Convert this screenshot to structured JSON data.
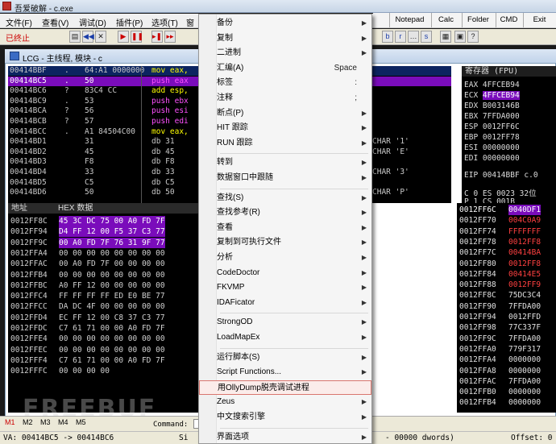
{
  "window": {
    "title": "吾爱破解 - c.exe"
  },
  "menu": [
    "文件(F)",
    "查看(V)",
    "调试(D)",
    "插件(P)",
    "选项(T)",
    "窗"
  ],
  "top_tabs": [
    "Notepad",
    "Calc",
    "Folder",
    "CMD",
    "Exit"
  ],
  "status": {
    "state": "已终止"
  },
  "toolbar": {
    "buttons": [
      "◀◀",
      "✕",
      "▶",
      "❚❚",
      "▸❚",
      "▸▸",
      "b",
      "r",
      "…",
      "s"
    ]
  },
  "pane": {
    "title": "LCG - 主线程, 模块 - c"
  },
  "cpu_rows": [
    {
      "addr": "00414BBF",
      "mark": ".",
      "hex": "64:A1 0000000",
      "asm": "mov eax,",
      "cls": "sel",
      "acls": "y"
    },
    {
      "addr": "00414BC5",
      "mark": ".",
      "hex": "50",
      "asm": "push eax",
      "cls": "hl",
      "acls": "m"
    },
    {
      "addr": "00414BC6",
      "mark": "?",
      "hex": "83C4 CC",
      "asm": "add esp,",
      "cls": "",
      "acls": "y"
    },
    {
      "addr": "00414BC9",
      "mark": ".",
      "hex": "53",
      "asm": "push ebx",
      "cls": "",
      "acls": "m"
    },
    {
      "addr": "00414BCA",
      "mark": "?",
      "hex": "56",
      "asm": "push esi",
      "cls": "",
      "acls": "m"
    },
    {
      "addr": "00414BCB",
      "mark": "?",
      "hex": "57",
      "asm": "push edi",
      "cls": "",
      "acls": "m"
    },
    {
      "addr": "00414BCC",
      "mark": ".",
      "hex": "A1 84504C00",
      "asm": "mov eax,",
      "cls": "",
      "acls": "y"
    },
    {
      "addr": "00414BD1",
      "mark": "",
      "hex": "31",
      "asm": "db 31",
      "cls": "",
      "acls": "",
      "cmt": "CHAR '1'"
    },
    {
      "addr": "00414BD2",
      "mark": "",
      "hex": "45",
      "asm": "db 45",
      "cls": "",
      "acls": "",
      "cmt": "CHAR 'E'"
    },
    {
      "addr": "00414BD3",
      "mark": "",
      "hex": "F8",
      "asm": "db F8",
      "cls": "",
      "acls": ""
    },
    {
      "addr": "00414BD4",
      "mark": "",
      "hex": "33",
      "asm": "db 33",
      "cls": "",
      "acls": "",
      "cmt": "CHAR '3'"
    },
    {
      "addr": "00414BD5",
      "mark": "",
      "hex": "C5",
      "asm": "db C5",
      "cls": "",
      "acls": ""
    },
    {
      "addr": "00414BD6",
      "mark": "",
      "hex": "50",
      "asm": "db 50",
      "cls": "",
      "acls": "",
      "cmt": "CHAR 'P'"
    }
  ],
  "registers": {
    "header": "寄存器 (FPU)",
    "rows": [
      {
        "name": "EAX",
        "val": "4FFCEB94",
        "hl": false
      },
      {
        "name": "ECX",
        "val": "4FFCEB94",
        "hl": true
      },
      {
        "name": "EDX",
        "val": "B003146B",
        "hl": false
      },
      {
        "name": "EBX",
        "val": "7FFDA000",
        "hl": false
      },
      {
        "name": "ESP",
        "val": "0012FF6C",
        "hl": false
      },
      {
        "name": "EBP",
        "val": "0012FF78",
        "hl": false
      },
      {
        "name": "ESI",
        "val": "00000000",
        "hl": false
      },
      {
        "name": "EDI",
        "val": "00000000",
        "hl": false
      },
      {
        "name": "EIP",
        "val": "00414BBF c.0",
        "hl": false
      },
      {
        "name": "C 0",
        "val": "ES 0023 32位",
        "hl": false
      },
      {
        "name": "P 1",
        "val": "CS 001B",
        "hl": false
      }
    ]
  },
  "dump": {
    "col_addr": "地址",
    "col_hex": "HEX 数据",
    "rows": [
      {
        "addr": "0012FF8C",
        "hex": "45 3C DC 75 00 A0 FD 7F",
        "sel": true
      },
      {
        "addr": "0012FF94",
        "hex": "D4 FF 12 00 F5 37 C3 77",
        "sel": true
      },
      {
        "addr": "0012FF9C",
        "hex": "00 A0 FD 7F 76 31 9F 77",
        "sel": true
      },
      {
        "addr": "0012FFA4",
        "hex": "00 00 00 00 00 00 00 00",
        "sel": false
      },
      {
        "addr": "0012FFAC",
        "hex": "00 A0 FD 7F 00 00 00 00",
        "sel": false
      },
      {
        "addr": "0012FFB4",
        "hex": "00 00 00 00 00 00 00 00",
        "sel": false
      },
      {
        "addr": "0012FFBC",
        "hex": "A0 FF 12 00 00 00 00 00",
        "sel": false
      },
      {
        "addr": "0012FFC4",
        "hex": "FF FF FF FF ED E0 BE 77",
        "sel": false
      },
      {
        "addr": "0012FFCC",
        "hex": "DA DC 4F 00 00 00 00 00",
        "sel": false
      },
      {
        "addr": "0012FFD4",
        "hex": "EC FF 12 00 C8 37 C3 77",
        "sel": false
      },
      {
        "addr": "0012FFDC",
        "hex": "C7 61 71 00 00 A0 FD 7F",
        "sel": false
      },
      {
        "addr": "0012FFE4",
        "hex": "00 00 00 00 00 00 00 00",
        "sel": false
      },
      {
        "addr": "0012FFEC",
        "hex": "00 00 00 00 00 00 00 00",
        "sel": false
      },
      {
        "addr": "0012FFF4",
        "hex": "C7 61 71 00 00 A0 FD 7F",
        "sel": false
      },
      {
        "addr": "0012FFFC",
        "hex": "00 00 00 00",
        "sel": false
      }
    ]
  },
  "stack": [
    {
      "addr": "0012FF6C",
      "val": "0040DF1",
      "top": true,
      "red": false
    },
    {
      "addr": "0012FF70",
      "val": "004C0A9",
      "top": false,
      "red": true
    },
    {
      "addr": "0012FF74",
      "val": "FFFFFFF",
      "top": false,
      "red": true
    },
    {
      "addr": "0012FF78",
      "val": "0012FF8",
      "top": false,
      "red": true
    },
    {
      "addr": "0012FF7C",
      "val": "00414BA",
      "top": false,
      "red": true
    },
    {
      "addr": "0012FF80",
      "val": "0012FF8",
      "top": false,
      "red": true
    },
    {
      "addr": "0012FF84",
      "val": "00414E5",
      "top": false,
      "red": true
    },
    {
      "addr": "0012FF88",
      "val": "0012FF9",
      "top": false,
      "red": true
    },
    {
      "addr": "0012FF8C",
      "val": "75DC3C4",
      "top": false,
      "red": false
    },
    {
      "addr": "0012FF90",
      "val": "7FFDA00",
      "top": false,
      "red": false
    },
    {
      "addr": "0012FF94",
      "val": "0012FFD",
      "top": false,
      "red": false
    },
    {
      "addr": "0012FF98",
      "val": "77C337F",
      "top": false,
      "red": false
    },
    {
      "addr": "0012FF9C",
      "val": "7FFDA00",
      "top": false,
      "red": false
    },
    {
      "addr": "0012FFA0",
      "val": "779F317",
      "top": false,
      "red": false
    },
    {
      "addr": "0012FFA4",
      "val": "0000000",
      "top": false,
      "red": false
    },
    {
      "addr": "0012FFA8",
      "val": "0000000",
      "top": false,
      "red": false
    },
    {
      "addr": "0012FFAC",
      "val": "7FFDA00",
      "top": false,
      "red": false
    },
    {
      "addr": "0012FFB0",
      "val": "0000000",
      "top": false,
      "red": false
    },
    {
      "addr": "0012FFB4",
      "val": "0000000",
      "top": false,
      "red": false
    }
  ],
  "bottom": {
    "tabs": [
      "M1",
      "M2",
      "M3",
      "M4",
      "M5"
    ],
    "command_label": "Command:",
    "va": "VA: 00414BC5 -> 00414BC6",
    "si": "Si",
    "dwords": "- 00000 dwords)",
    "offset": "Offset: 0"
  },
  "watermark": "FREEBUF",
  "context_menu": [
    {
      "label": "备份",
      "arrow": true
    },
    {
      "label": "复制",
      "arrow": true
    },
    {
      "label": "二进制",
      "arrow": true
    },
    {
      "label": "汇编(A)",
      "shortcut": "Space"
    },
    {
      "label": "标签",
      "shortcut": ":"
    },
    {
      "label": "注释",
      "shortcut": ";"
    },
    {
      "label": "断点(P)",
      "arrow": true
    },
    {
      "label": "HIT 跟踪",
      "arrow": true
    },
    {
      "label": "RUN 跟踪",
      "arrow": true
    },
    {
      "sep": true
    },
    {
      "label": "转到",
      "arrow": true
    },
    {
      "label": "数据窗口中跟随",
      "arrow": true
    },
    {
      "sep": true
    },
    {
      "label": "查找(S)",
      "arrow": true
    },
    {
      "label": "查找参考(R)",
      "arrow": true
    },
    {
      "label": "查看",
      "arrow": true
    },
    {
      "label": "复制到可执行文件",
      "arrow": true
    },
    {
      "label": "分析",
      "arrow": true
    },
    {
      "label": "CodeDoctor",
      "arrow": true
    },
    {
      "label": "FKVMP",
      "arrow": true
    },
    {
      "label": "IDAFicator",
      "arrow": true
    },
    {
      "sep": true
    },
    {
      "label": "StrongOD",
      "arrow": true
    },
    {
      "label": "LoadMapEx",
      "arrow": true
    },
    {
      "sep": true
    },
    {
      "label": "运行脚本(S)",
      "arrow": true
    },
    {
      "label": "Script Functions...",
      "arrow": true
    },
    {
      "label": "用OllyDump脱壳调试进程",
      "arrow": false,
      "highlight": true
    },
    {
      "label": "Zeus",
      "arrow": true
    },
    {
      "label": "中文搜索引擎",
      "arrow": true
    },
    {
      "sep": true
    },
    {
      "label": "界面选项",
      "arrow": true
    }
  ]
}
